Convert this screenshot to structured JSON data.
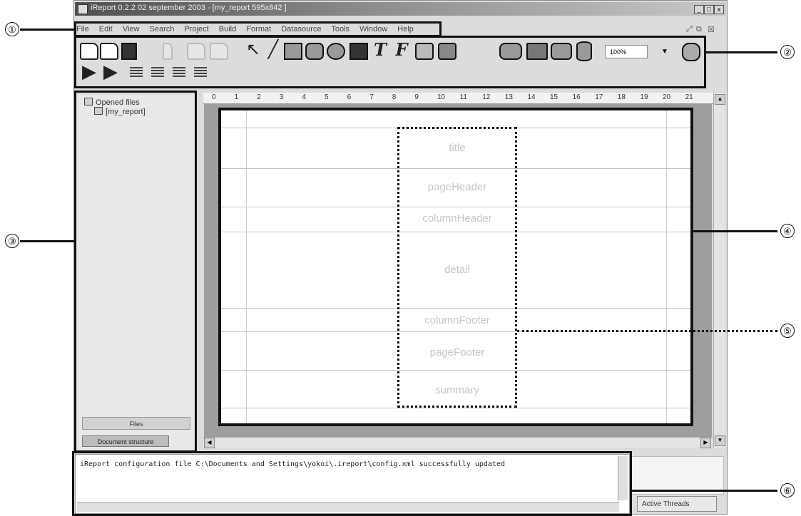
{
  "window": {
    "title": "iReport 0.2.2 02 september 2003 - [my_report 595x842 ]",
    "controls": [
      "_",
      "□",
      "x"
    ]
  },
  "menu": {
    "items": [
      "File",
      "Edit",
      "View",
      "Search",
      "Project",
      "Build",
      "Format",
      "Datasource",
      "Tools",
      "Window",
      "Help"
    ]
  },
  "toolbar": {
    "zoom_value": "100%",
    "icons": [
      "new-icon",
      "open-icon",
      "save-icon",
      "cut-icon",
      "copy-icon",
      "paste-icon",
      "pointer-icon",
      "line-icon",
      "rectangle-icon",
      "round-rectangle-icon",
      "ellipse-icon",
      "image-icon",
      "static-text-icon",
      "text-field-icon",
      "subreport-icon",
      "chart-icon",
      "band-icon",
      "group-icon",
      "page-icon",
      "database-icon",
      "run-icon",
      "run-db-icon",
      "align-left-icon",
      "align-center-icon",
      "align-right-icon",
      "align-justify-icon"
    ]
  },
  "left_panel": {
    "root_label": "Opened files",
    "child_label": "[my_report]",
    "tab_files": "Files",
    "tab_document_structure": "Document structure"
  },
  "ruler": {
    "ticks": [
      "0",
      "1",
      "2",
      "3",
      "4",
      "5",
      "6",
      "7",
      "8",
      "9",
      "10",
      "11",
      "12",
      "13",
      "14",
      "15",
      "16",
      "17",
      "18",
      "19",
      "20",
      "21"
    ]
  },
  "report": {
    "bands": [
      "title",
      "pageHeader",
      "columnHeader",
      "detail",
      "columnFooter",
      "pageFooter",
      "summary"
    ]
  },
  "console": {
    "message": "iReport configuration file C:\\Documents and Settings\\yokoi\\.ireport\\config.xml successfully updated"
  },
  "bottom_tabs": {
    "active_threads": "Active Threads"
  },
  "annotations": {
    "labels": [
      "①",
      "②",
      "③",
      "④",
      "⑤",
      "⑥"
    ]
  }
}
